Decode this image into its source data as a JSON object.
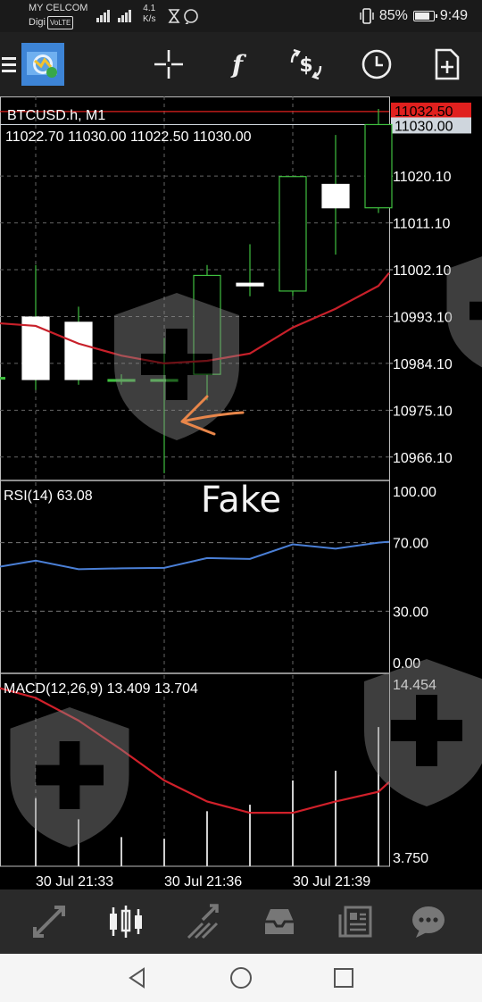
{
  "status_bar": {
    "carrier": "MY CELCOM",
    "carrier2": "Digi",
    "volte": "VoLTE",
    "net_speed_value": "4.1",
    "net_speed_unit": "K/s",
    "battery_percent": "85%",
    "battery_level": 0.85,
    "time": "9:49"
  },
  "toolbar": {
    "icons": [
      "menu-icon",
      "app-logo-icon",
      "crosshair-icon",
      "indicators-icon",
      "trade-icon",
      "history-icon",
      "new-order-icon"
    ]
  },
  "chart": {
    "symbol_header": "BTCUSD.h, M1",
    "ohlc": "11022.70 11030.00 11022.50 11030.00",
    "price_labels": [
      "11020.10",
      "11011.10",
      "11002.10",
      "10993.10",
      "10984.10",
      "10975.10",
      "10966.10"
    ],
    "ask_label": "11032.50",
    "bid_label": "11030.00",
    "ask_color": "#e0201e",
    "bid_color": "#cfd6dd",
    "annotation_text": "Fake",
    "annotation_color": "#e8864a",
    "rsi_header": "RSI(14) 63.08",
    "rsi_levels": [
      "100.00",
      "70.00",
      "30.00",
      "0.00"
    ],
    "macd_header": "MACD(12,26,9) 13.409 13.704",
    "macd_levels": [
      "14.454",
      "3.750"
    ],
    "time_labels": [
      "30 Jul 21:33",
      "30 Jul 21:36",
      "30 Jul 21:39"
    ],
    "candle_up_color": "#3fbf3f",
    "candle_body_color": "#ffffff",
    "ma_color": "#c8202a",
    "rsi_color": "#4a7fd6",
    "macd_signal_color": "#d0202a"
  },
  "chart_data": {
    "type": "candlestick",
    "symbol": "BTCUSD.h",
    "timeframe": "M1",
    "candles": [
      {
        "open": 10993.0,
        "high": 11003.0,
        "low": 10979.0,
        "close": 10981.0
      },
      {
        "open": 10992.0,
        "high": 10995.0,
        "low": 10980.0,
        "close": 10981.0
      },
      {
        "open": 10981.0,
        "high": 10982.0,
        "low": 10980.0,
        "close": 10981.0
      },
      {
        "open": 10981.0,
        "high": 10989.0,
        "low": 10963.0,
        "close": 10981.0
      },
      {
        "open": 10982.0,
        "high": 11003.0,
        "low": 10977.0,
        "close": 11001.0
      },
      {
        "open": 10999.5,
        "high": 11007.0,
        "low": 10997.0,
        "close": 10999.0
      },
      {
        "open": 10998.0,
        "high": 11018.0,
        "low": 10997.0,
        "close": 11020.0
      },
      {
        "open": 11018.5,
        "high": 11028.0,
        "low": 11005.0,
        "close": 11014.0
      },
      {
        "open": 11014.0,
        "high": 11033.0,
        "low": 11013.0,
        "close": 11030.0
      }
    ],
    "ma": [
      10991.3,
      10987.9,
      10985.6,
      10984.1,
      10984.6,
      10986.0,
      10991.0,
      10994.6,
      10999.0
    ],
    "rsi": [
      59.5,
      54.5,
      55.0,
      55.3,
      61.0,
      60.5,
      69.0,
      66.5,
      70.0
    ],
    "rsi_ylim": [
      0,
      100
    ],
    "macd_signal": [
      13.6,
      12.2,
      10.4,
      8.5,
      7.2,
      6.5,
      6.5,
      7.2,
      7.8
    ],
    "macd_ylim": [
      3.75,
      14.454
    ],
    "ylim": [
      10961.6,
      11035.4
    ]
  },
  "bottom_nav": {
    "icons": [
      "quotes-icon",
      "chart-icon",
      "trade-icon",
      "history-icon",
      "news-icon",
      "chat-icon"
    ],
    "active_index": 1
  },
  "system_nav": {
    "icons": [
      "back-icon",
      "home-icon",
      "recents-icon"
    ]
  }
}
